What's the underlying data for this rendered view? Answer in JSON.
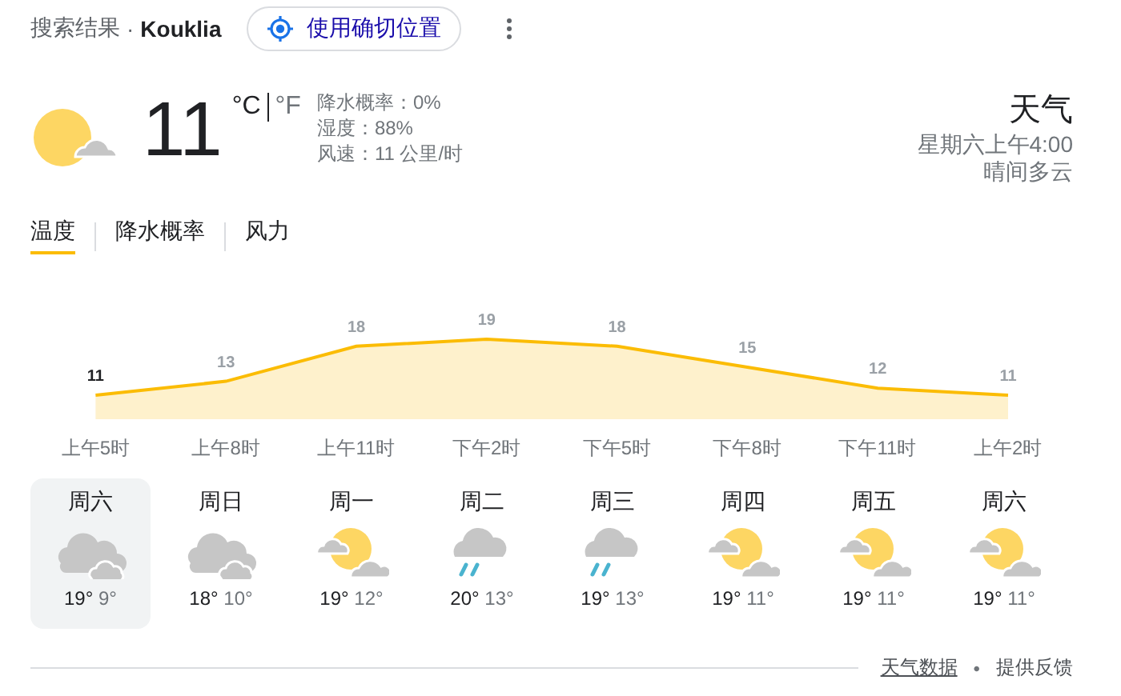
{
  "header": {
    "label": "搜索结果",
    "separator": "·",
    "location": "Kouklia",
    "location_button": "使用确切位置"
  },
  "current": {
    "temperature": "11",
    "units": [
      {
        "label": "°C",
        "selected": true
      },
      {
        "label": "°F",
        "selected": false
      }
    ],
    "details": [
      "降水概率：0%",
      "湿度：88%",
      "风速：11 公里/时"
    ],
    "title": "天气",
    "time": "星期六上午4:00",
    "condition": "晴间多云"
  },
  "tabs": [
    {
      "label": "温度",
      "selected": true
    },
    {
      "label": "降水概率",
      "selected": false
    },
    {
      "label": "风力",
      "selected": false
    }
  ],
  "chart_data": {
    "type": "area",
    "categories": [
      "上午5时",
      "上午8时",
      "上午11时",
      "下午2时",
      "下午5时",
      "下午8时",
      "下午11时",
      "上午2时"
    ],
    "values": [
      11,
      13,
      18,
      19,
      18,
      15,
      12,
      11
    ],
    "data_labels": true
  },
  "days": [
    {
      "day": "周六",
      "kind": "cloudy",
      "high": "19°",
      "low": "9°",
      "selected": true
    },
    {
      "day": "周日",
      "kind": "cloudy",
      "high": "18°",
      "low": "10°",
      "selected": false
    },
    {
      "day": "周一",
      "kind": "partly_cloudy",
      "high": "19°",
      "low": "12°",
      "selected": false
    },
    {
      "day": "周二",
      "kind": "rain",
      "high": "20°",
      "low": "13°",
      "selected": false
    },
    {
      "day": "周三",
      "kind": "rain",
      "high": "19°",
      "low": "13°",
      "selected": false
    },
    {
      "day": "周四",
      "kind": "partly_cloudy",
      "high": "19°",
      "low": "11°",
      "selected": false
    },
    {
      "day": "周五",
      "kind": "partly_cloudy",
      "high": "19°",
      "low": "11°",
      "selected": false
    },
    {
      "day": "周六",
      "kind": "partly_cloudy",
      "high": "19°",
      "low": "11°",
      "selected": false
    }
  ],
  "footer": {
    "source_link": "天气数据",
    "separator": "•",
    "feedback_link": "提供反馈"
  }
}
